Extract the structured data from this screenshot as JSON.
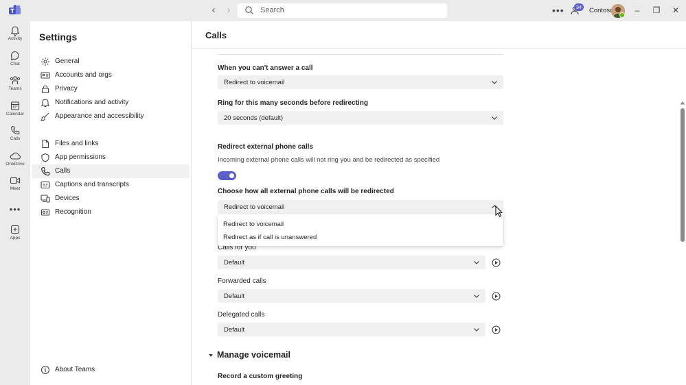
{
  "titlebar": {
    "search_placeholder": "Search",
    "notification_count": "34",
    "org_name": "Contoso"
  },
  "rail": {
    "items": [
      {
        "label": "Activity",
        "icon": "bell-icon"
      },
      {
        "label": "Chat",
        "icon": "chat-icon"
      },
      {
        "label": "Teams",
        "icon": "teams-icon"
      },
      {
        "label": "Calendar",
        "icon": "calendar-icon"
      },
      {
        "label": "Calls",
        "icon": "phone-icon"
      },
      {
        "label": "OneDrive",
        "icon": "cloud-icon"
      },
      {
        "label": "Meet",
        "icon": "video-icon"
      },
      {
        "label": "Apps",
        "icon": "apps-icon"
      }
    ]
  },
  "settings": {
    "title": "Settings",
    "items": [
      {
        "label": "General",
        "icon": "gear-icon"
      },
      {
        "label": "Accounts and orgs",
        "icon": "accounts-icon"
      },
      {
        "label": "Privacy",
        "icon": "lock-icon"
      },
      {
        "label": "Notifications and activity",
        "icon": "bell-icon"
      },
      {
        "label": "Appearance and accessibility",
        "icon": "brush-icon"
      },
      {
        "label": "Files and links",
        "icon": "file-icon"
      },
      {
        "label": "App permissions",
        "icon": "shield-icon"
      },
      {
        "label": "Calls",
        "icon": "phone-icon"
      },
      {
        "label": "Captions and transcripts",
        "icon": "captions-icon"
      },
      {
        "label": "Devices",
        "icon": "devices-icon"
      },
      {
        "label": "Recognition",
        "icon": "recognition-icon"
      }
    ],
    "selected": "Calls",
    "about": "About Teams"
  },
  "main": {
    "title": "Calls",
    "cant_answer": {
      "label": "When you can't answer a call",
      "value": "Redirect to voicemail"
    },
    "ring_seconds": {
      "label": "Ring for this many seconds before redirecting",
      "value": "20 seconds (default)"
    },
    "redirect_external": {
      "label": "Redirect external phone calls",
      "description": "Incoming external phone calls will not ring you and be redirected as specified",
      "toggle_on": true
    },
    "choose_redirect": {
      "label": "Choose how all external phone calls will be redirected",
      "value": "Redirect to voicemail",
      "options": [
        "Redirect to voicemail",
        "Redirect as if call is unanswered"
      ]
    },
    "ringtones": [
      {
        "label": "Calls for you",
        "value": "Default"
      },
      {
        "label": "Forwarded calls",
        "value": "Default"
      },
      {
        "label": "Delegated calls",
        "value": "Default"
      }
    ],
    "voicemail_section": "Manage voicemail",
    "custom_greeting": "Record a custom greeting"
  },
  "colors": {
    "accent": "#5b5fc7",
    "presence_available": "#6bb700"
  }
}
